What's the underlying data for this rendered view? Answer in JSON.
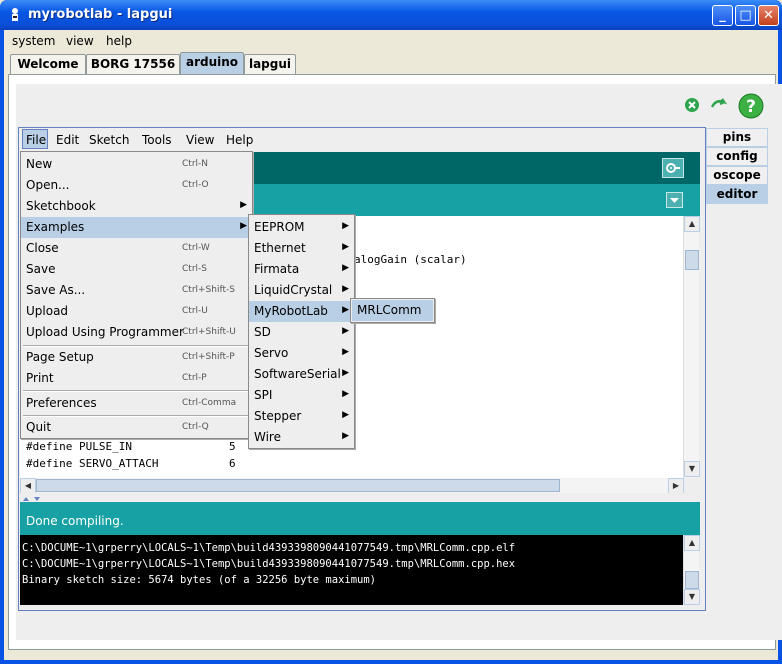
{
  "window": {
    "title": "myrobotlab - lapgui",
    "minimize": "_",
    "maximize": "□",
    "close": "✕"
  },
  "menubar": {
    "items": [
      "system",
      "view",
      "help"
    ]
  },
  "tabs": [
    {
      "label": "Welcome"
    },
    {
      "label": "BORG 17556"
    },
    {
      "label": "arduino"
    },
    {
      "label": "lapgui"
    }
  ],
  "side_tabs": [
    {
      "label": "pins"
    },
    {
      "label": "config"
    },
    {
      "label": "oscope"
    },
    {
      "label": "editor"
    }
  ],
  "toolbar_icons": [
    "stop-icon",
    "detach-icon",
    "help-icon"
  ],
  "arduino_menubar": [
    "File",
    "Edit",
    "Sketch",
    "Tools",
    "View",
    "Help"
  ],
  "file_menu": [
    {
      "label": "New",
      "accel": "Ctrl-N"
    },
    {
      "label": "Open...",
      "accel": "Ctrl-O"
    },
    {
      "label": "Sketchbook",
      "submenu": true
    },
    {
      "label": "Examples",
      "submenu": true
    },
    {
      "label": "Close",
      "accel": "Ctrl-W"
    },
    {
      "label": "Save",
      "accel": "Ctrl-S"
    },
    {
      "label": "Save As...",
      "accel": "Ctrl+Shift-S"
    },
    {
      "label": "Upload",
      "accel": "Ctrl-U"
    },
    {
      "label": "Upload Using Programmer",
      "accel": "Ctrl+Shift-U"
    },
    {
      "label": "Page Setup",
      "accel": "Ctrl+Shift-P"
    },
    {
      "label": "Print",
      "accel": "Ctrl-P"
    },
    {
      "label": "Preferences",
      "accel": "Ctrl-Comma"
    },
    {
      "label": "Quit",
      "accel": "Ctrl-Q"
    }
  ],
  "examples_menu": [
    "EEPROM",
    "Ethernet",
    "Firmata",
    "LiquidCrystal",
    "MyRobotLab",
    "SD",
    "Servo",
    "SoftwareSerial",
    "SPI",
    "Stepper",
    "Wire"
  ],
  "myrobotlab_menu": [
    "MRLComm"
  ],
  "code": {
    "fragment": "alogGain (scalar)",
    "line1": "#define PULSE_IN",
    "line1_val": "5",
    "line2": "#define SERVO_ATTACH",
    "line2_val": "6"
  },
  "status": "Done compiling.",
  "console": [
    "C:\\DOCUME~1\\grperry\\LOCALS~1\\Temp\\build4393398090441077549.tmp\\MRLComm.cpp.elf",
    "C:\\DOCUME~1\\grperry\\LOCALS~1\\Temp\\build4393398090441077549.tmp\\MRLComm.cpp.hex",
    "Binary sketch size: 5674 bytes (of a 32256 byte maximum)"
  ],
  "colors": {
    "teal_dark": "#006666",
    "teal": "#17a1a5",
    "highlight": "#b8cfe5",
    "xp_blue": "#0853e5"
  }
}
